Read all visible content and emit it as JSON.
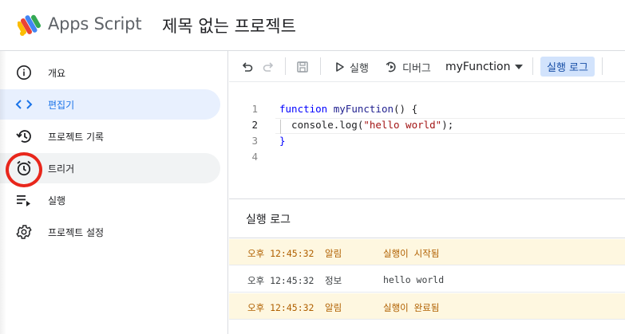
{
  "header": {
    "app_name": "Apps Script",
    "project_title": "제목 없는 프로젝트"
  },
  "sidebar": {
    "items": [
      {
        "label": "개요",
        "icon": "info-icon",
        "state": "normal"
      },
      {
        "label": "편집기",
        "icon": "code-icon",
        "state": "active"
      },
      {
        "label": "프로젝트 기록",
        "icon": "history-icon",
        "state": "normal"
      },
      {
        "label": "트리거",
        "icon": "alarm-clock-icon",
        "state": "hover"
      },
      {
        "label": "실행",
        "icon": "executions-icon",
        "state": "normal"
      },
      {
        "label": "프로젝트 설정",
        "icon": "gear-icon",
        "state": "normal"
      }
    ]
  },
  "toolbar": {
    "run_label": "실행",
    "debug_label": "디버그",
    "function_name": "myFunction",
    "log_toggle_label": "실행 로그"
  },
  "editor": {
    "lines": [
      {
        "num": "1",
        "text": "function myFunction() {"
      },
      {
        "num": "2",
        "text": "  console.log(\"hello world\");"
      },
      {
        "num": "3",
        "text": "}"
      },
      {
        "num": "4",
        "text": ""
      }
    ]
  },
  "log": {
    "title": "실행 로그",
    "rows": [
      {
        "time": "오후 12:45:32",
        "level": "알림",
        "message": "실행이 시작됨",
        "type": "warn"
      },
      {
        "time": "오후 12:45:32",
        "level": "정보",
        "message": "hello world",
        "type": "info"
      },
      {
        "time": "오후 12:45:32",
        "level": "알림",
        "message": "실행이 완료됨",
        "type": "warn"
      }
    ]
  },
  "colors": {
    "accent": "#1a73e8",
    "active_bg": "#e8f0fe",
    "warn_bg": "#fef7e0",
    "warn_text": "#b06000",
    "highlight_ring": "#e8261b"
  }
}
